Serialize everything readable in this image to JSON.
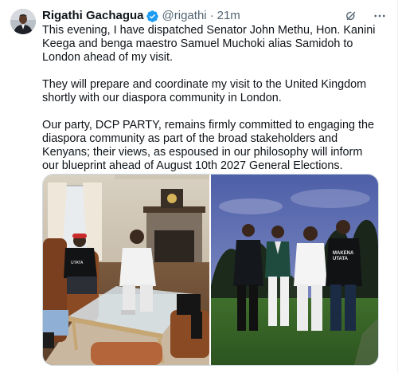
{
  "author": {
    "name": "Rigathi Gachagua",
    "handle": "@rigathi",
    "separator": "·",
    "time": "21m",
    "verified_color": "#1d9bf0"
  },
  "icons": {
    "verified": "verified-badge-icon",
    "grok": "grok-explain-icon",
    "more": "more-options-icon"
  },
  "body": {
    "paragraphs": [
      "This evening, I have dispatched Senator John Methu, Hon. Kanini Keega and benga maestro Samuel Muchoki alias Samidoh to London ahead of my visit.",
      "They will prepare and coordinate my visit to the United Kingdom shortly with our diaspora community in London.",
      "Our party, DCP PARTY, remains firmly committed to engaging the diaspora community as part of the broad stakeholders and Kenyans; their views, as espoused in our philosophy will inform our blueprint ahead of August 10th 2027 General Elections."
    ]
  },
  "media": {
    "photo_2_shirt_text": "MAKENA\nUTATA",
    "photo_1_shirt_text": "UTATA"
  },
  "colors": {
    "text": "#0f1419",
    "muted": "#536471",
    "border": "#cfd9de"
  }
}
